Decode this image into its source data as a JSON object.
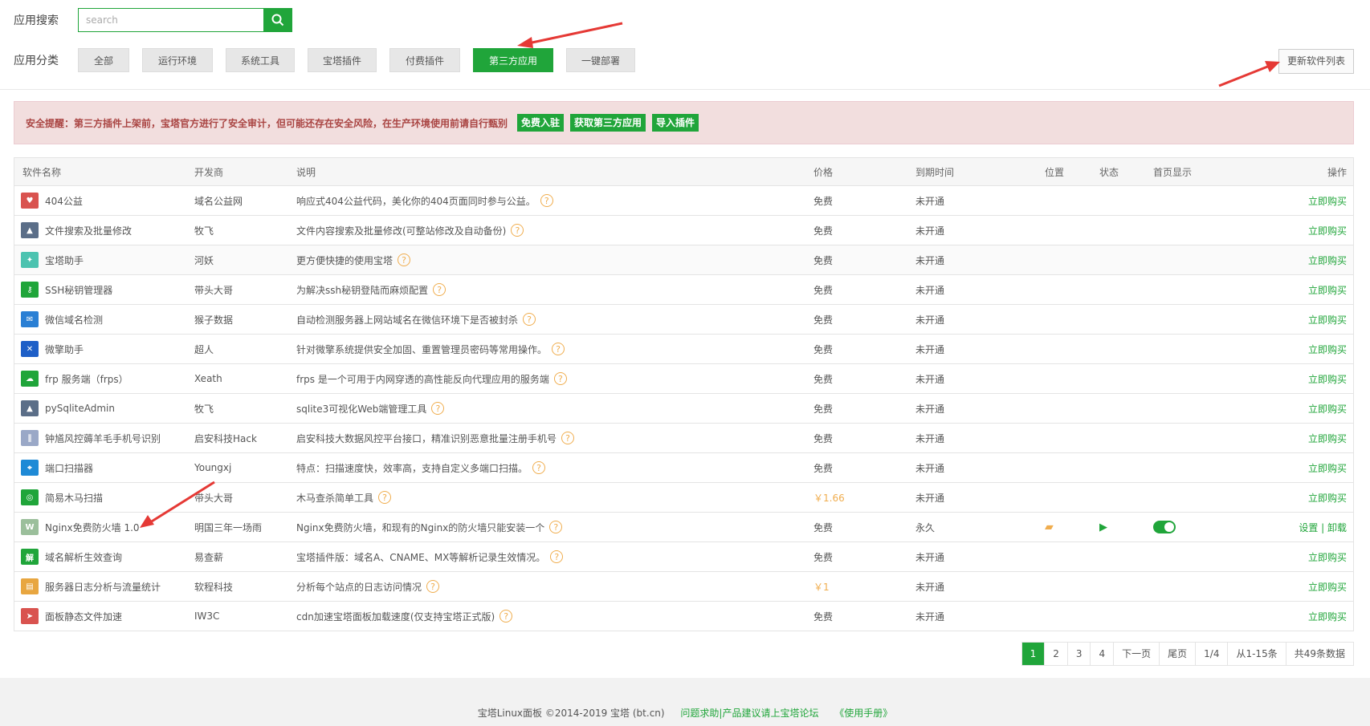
{
  "search": {
    "label": "应用搜索",
    "placeholder": "search"
  },
  "categories": {
    "label": "应用分类",
    "items": [
      "全部",
      "运行环境",
      "系统工具",
      "宝塔插件",
      "付费插件",
      "第三方应用",
      "一键部署"
    ],
    "active": "第三方应用"
  },
  "update_button": "更新软件列表",
  "alert": {
    "text": "安全提醒：第三方插件上架前，宝塔官方进行了安全审计，但可能还存在安全风险，在生产环境使用前请自行甄别",
    "buttons": [
      "免费入驻",
      "获取第三方应用",
      "导入插件"
    ]
  },
  "table": {
    "headers": {
      "name": "软件名称",
      "dev": "开发商",
      "desc": "说明",
      "price": "价格",
      "expire": "到期时间",
      "position": "位置",
      "status": "状态",
      "home": "首页显示",
      "op": "操作"
    },
    "rows": [
      {
        "name": "404公益",
        "dev": "域名公益网",
        "desc": "响应式404公益代码，美化你的404页面同时参与公益。",
        "price": "免费",
        "expire": "未开通",
        "op": "立即购买",
        "icon": "heart-icon",
        "color": "#d9534f"
      },
      {
        "name": "文件搜索及批量修改",
        "dev": "牧飞",
        "desc": "文件内容搜索及批量修改(可整站修改及自动备份)",
        "price": "免费",
        "expire": "未开通",
        "op": "立即购买",
        "icon": "landscape-icon",
        "color": "#5b6e88"
      },
      {
        "name": "宝塔助手",
        "dev": "河妖",
        "desc": "更方便快捷的使用宝塔",
        "price": "免费",
        "expire": "未开通",
        "op": "立即购买",
        "icon": "assistant-icon",
        "color": "#4cc3b0"
      },
      {
        "name": "SSH秘钥管理器",
        "dev": "带头大哥",
        "desc": "为解决ssh秘钥登陆而麻烦配置",
        "price": "免费",
        "expire": "未开通",
        "op": "立即购买",
        "icon": "key-icon",
        "color": "#20a53a"
      },
      {
        "name": "微信域名检测",
        "dev": "猴子数据",
        "desc": "自动检测服务器上网站域名在微信环境下是否被封杀",
        "price": "免费",
        "expire": "未开通",
        "op": "立即购买",
        "icon": "wechat-icon",
        "color": "#2a7fd4"
      },
      {
        "name": "微擎助手",
        "dev": "超人",
        "desc": "针对微擎系统提供安全加固、重置管理员密码等常用操作。",
        "price": "免费",
        "expire": "未开通",
        "op": "立即购买",
        "icon": "tools-icon",
        "color": "#1e5fc7"
      },
      {
        "name": "frp 服务端（frps）",
        "dev": "Xeath",
        "desc": "frps 是一个可用于内网穿透的高性能反向代理应用的服务端",
        "price": "免费",
        "expire": "未开通",
        "op": "立即购买",
        "icon": "cloud-icon",
        "color": "#20a53a"
      },
      {
        "name": "pySqliteAdmin",
        "dev": "牧飞",
        "desc": "sqlite3可视化Web端管理工具",
        "price": "免费",
        "expire": "未开通",
        "op": "立即购买",
        "icon": "landscape-icon",
        "color": "#5b6e88"
      },
      {
        "name": "钟馗风控薅羊毛手机号识别",
        "dev": "启安科技Hack",
        "desc": "启安科技大数据风控平台接口，精准识别恶意批量注册手机号",
        "price": "免费",
        "expire": "未开通",
        "op": "立即购买",
        "icon": "bars-icon",
        "color": "#9aa8c7"
      },
      {
        "name": "端口扫描器",
        "dev": "Youngxj",
        "desc": "特点：扫描速度快，效率高，支持自定义多端口扫描。",
        "price": "免费",
        "expire": "未开通",
        "op": "立即购买",
        "icon": "scanner-icon",
        "color": "#1e8ad6"
      },
      {
        "name": "简易木马扫描",
        "dev": "带头大哥",
        "desc": "木马查杀简单工具",
        "price": "￥1.66",
        "expire": "未开通",
        "op": "立即购买",
        "icon": "target-icon",
        "color": "#20a53a"
      },
      {
        "name": "Nginx免费防火墙 1.0",
        "dev": "明国三年一场雨",
        "desc": "Nginx免费防火墙，和现有的Nginx的防火墙只能安装一个",
        "price": "免费",
        "expire": "永久",
        "op": "设置 | 卸载",
        "icon": "waf-icon",
        "color": "#9bbf9b",
        "installed": true
      },
      {
        "name": "域名解析生效查询",
        "dev": "易查薪",
        "desc": "宝塔插件版：域名A、CNAME、MX等解析记录生效情况。",
        "price": "免费",
        "expire": "未开通",
        "op": "立即购买",
        "icon": "dns-icon",
        "color": "#20a53a"
      },
      {
        "name": "服务器日志分析与流量统计",
        "dev": "软程科技",
        "desc": "分析每个站点的日志访问情况",
        "price": "￥1",
        "expire": "未开通",
        "op": "立即购买",
        "icon": "chart-icon",
        "color": "#e8a640"
      },
      {
        "name": "面板静态文件加速",
        "dev": "IW3C",
        "desc": "cdn加速宝塔面板加载速度(仅支持宝塔正式版)",
        "price": "免费",
        "expire": "未开通",
        "op": "立即购买",
        "icon": "speed-icon",
        "color": "#d9534f"
      }
    ]
  },
  "pager": [
    "1",
    "2",
    "3",
    "4",
    "下一页",
    "尾页",
    "1/4",
    "从1-15条",
    "共49条数据"
  ],
  "footer": {
    "copyright": "宝塔Linux面板 ©2014-2019 宝塔 (bt.cn)",
    "forum": "问题求助|产品建议请上宝塔论坛",
    "manual": "《使用手册》"
  }
}
